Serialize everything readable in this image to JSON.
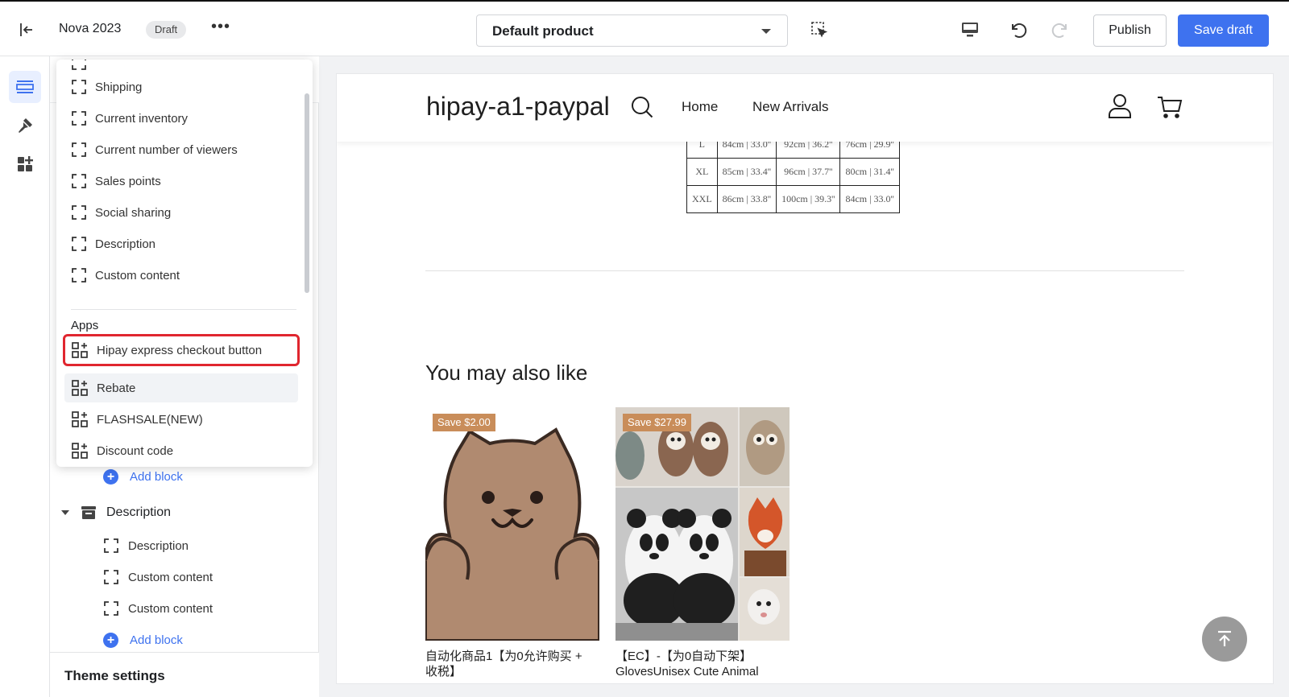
{
  "topbar": {
    "store_name": "Nova 2023",
    "status_badge": "Draft",
    "more_label": "•••",
    "template_select": "Default product",
    "publish_label": "Publish",
    "save_label": "Save draft"
  },
  "rail": {
    "items": [
      {
        "icon": "sections-icon",
        "active": true
      },
      {
        "icon": "theme-style-icon",
        "active": false
      },
      {
        "icon": "apps-icon",
        "active": false
      }
    ]
  },
  "popover": {
    "top_partial": "",
    "items": [
      "Shipping",
      "Current inventory",
      "Current number of viewers",
      "Sales points",
      "Social sharing",
      "Description",
      "Custom content"
    ],
    "apps_heading": "Apps",
    "apps": [
      "Hipay express checkout button",
      "Rebate",
      "FLASHSALE(NEW)",
      "Discount code"
    ],
    "selected_app": "Hipay express checkout button",
    "hover_app": "Rebate"
  },
  "panel": {
    "add_block_label": "Add block",
    "section_name": "Description",
    "section_blocks": [
      "Description",
      "Custom content",
      "Custom content"
    ],
    "add_block_label_2": "Add block",
    "theme_settings": "Theme settings"
  },
  "preview": {
    "logo": "hipay-a1-paypal",
    "nav": [
      "Home",
      "New Arrivals"
    ],
    "size_table": [
      [
        "L",
        "84cm | 33.0''",
        "92cm | 36.2''",
        "76cm | 29.9''"
      ],
      [
        "XL",
        "85cm | 33.4''",
        "96cm | 37.7''",
        "80cm | 31.4''"
      ],
      [
        "XXL",
        "86cm | 33.8''",
        "100cm | 39.3''",
        "84cm | 33.0''"
      ]
    ],
    "also_like": "You may also like",
    "products": [
      {
        "badge": "Save $2.00",
        "title_line1": "自动化商品1【为0允许购买 +",
        "title_line2": "收税】"
      },
      {
        "badge": "Save $27.99",
        "title_line1": "【EC】-【为0自动下架】",
        "title_line2": "GlovesUnisex Cute Animal"
      }
    ]
  },
  "colors": {
    "accent": "#3e72ef",
    "highlight_outline": "#e0262f",
    "badge": "#c98d5a"
  }
}
